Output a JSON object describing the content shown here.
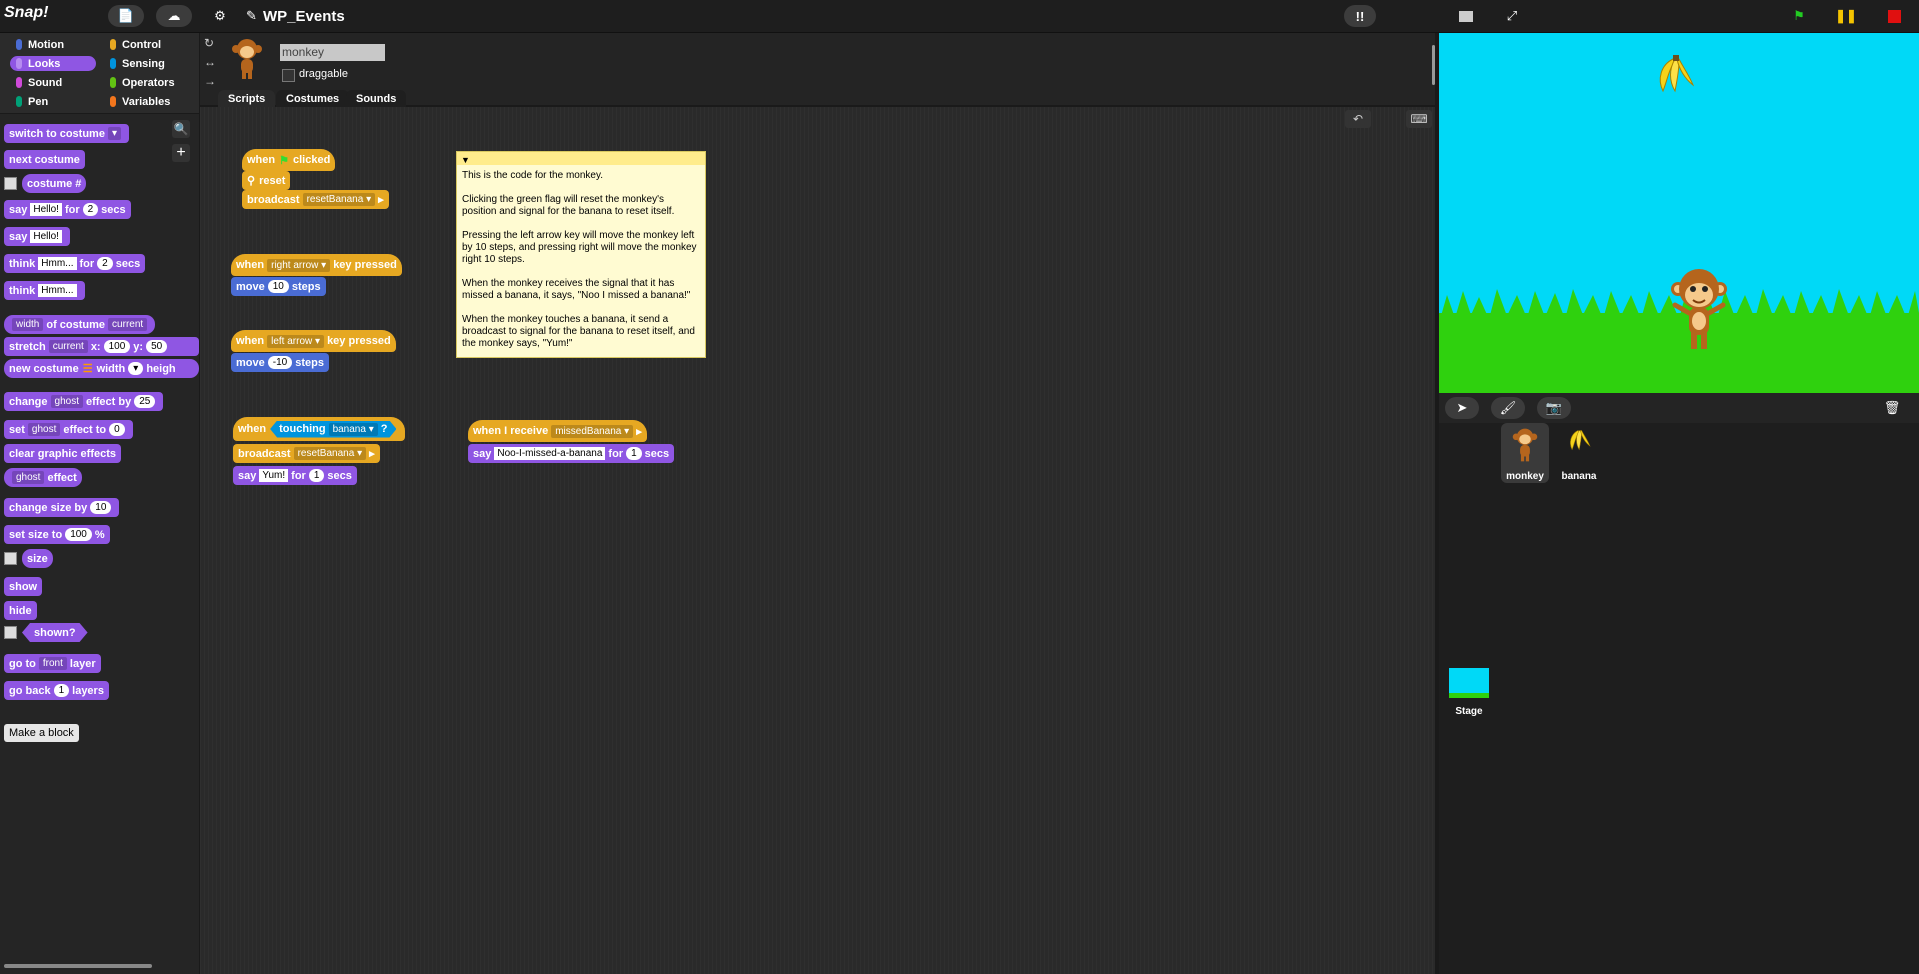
{
  "app": {
    "logo_text": "Snap!",
    "project_title": "WP_Events"
  },
  "categories": [
    {
      "label": "Motion",
      "color": "#4a6cd4",
      "selected": false
    },
    {
      "label": "Control",
      "color": "#e6a822",
      "selected": false
    },
    {
      "label": "Looks",
      "color": "#8f56e3",
      "selected": true
    },
    {
      "label": "Sensing",
      "color": "#0094dd",
      "selected": false
    },
    {
      "label": "Sound",
      "color": "#cf4ad9",
      "selected": false
    },
    {
      "label": "Operators",
      "color": "#62c213",
      "selected": false
    },
    {
      "label": "Pen",
      "color": "#00a178",
      "selected": false
    },
    {
      "label": "Variables",
      "color": "#f3761d",
      "selected": false
    }
  ],
  "palette": {
    "switch_to_costume": "switch to costume",
    "next_costume": "next costume",
    "costume_num": "costume #",
    "say": "say",
    "hello": "Hello!",
    "for": "for",
    "two": "2",
    "secs": "secs",
    "think": "think",
    "hmm": "Hmm...",
    "width": "width",
    "of_costume": "of costume",
    "current": "current",
    "stretch": "stretch",
    "x": "x:",
    "hundred": "100",
    "y": "y:",
    "fifty": "50",
    "new_costume": "new costume",
    "width_lbl": "width",
    "heigh": "heigh",
    "change": "change",
    "ghost": "ghost",
    "effect_by": "effect by",
    "twentyfive": "25",
    "set": "set",
    "effect_to": "effect to",
    "zero": "0",
    "clear_graphic_effects": "clear graphic effects",
    "effect": "effect",
    "change_size_by": "change size by",
    "ten": "10",
    "set_size_to": "set size to",
    "percent": "%",
    "size": "size",
    "show": "show",
    "hide": "hide",
    "shown": "shown?",
    "go_to": "go to",
    "front": "front",
    "layer": "layer",
    "go_back": "go back",
    "one": "1",
    "layers": "layers",
    "make_a_block": "Make a block"
  },
  "sprite": {
    "name": "monkey",
    "draggable_label": "draggable"
  },
  "tabs": [
    "Scripts",
    "Costumes",
    "Sounds"
  ],
  "scripts": {
    "when": "when",
    "clicked": "clicked",
    "reset": "reset",
    "broadcast": "broadcast",
    "resetBanana": "resetBanana",
    "right_arrow": "right arrow",
    "key_pressed": "key pressed",
    "move": "move",
    "ten": "10",
    "steps": "steps",
    "left_arrow": "left arrow",
    "neg_ten": "-10",
    "touching": "touching",
    "banana": "banana",
    "q": "?",
    "say": "say",
    "yum": "Yum!",
    "for": "for",
    "one": "1",
    "secs": "secs",
    "when_i_receive": "when I receive",
    "missedBanana": "missedBanana",
    "noo_text": "Noo-I-missed-a-banana"
  },
  "comment": "This is the code for the monkey.\n\nClicking the green flag will reset the monkey's position and signal for the banana to reset itself.\n\nPressing the left arrow key will move the monkey left by 10 steps, and pressing right will move the monkey right 10 steps.\n\nWhen the monkey receives the signal that it has missed a banana, it says, \"Noo I missed a banana!\"\n\nWhen the monkey touches a banana, it send a broadcast to signal for the banana to reset itself, and the monkey says, \"Yum!\"",
  "corral": {
    "sprites": [
      {
        "name": "monkey"
      },
      {
        "name": "banana"
      }
    ],
    "stage_label": "Stage"
  }
}
